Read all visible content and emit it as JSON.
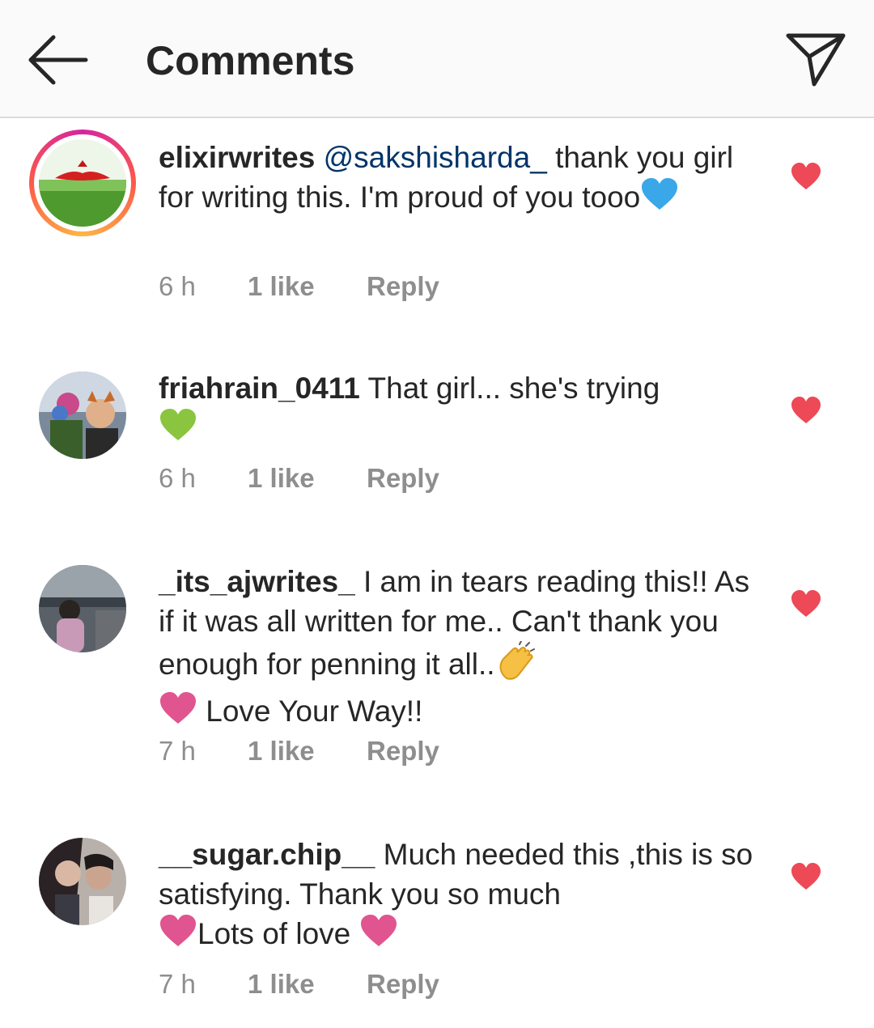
{
  "header": {
    "title": "Comments",
    "back_icon": "arrow-left-icon",
    "send_icon": "paper-plane-icon"
  },
  "colors": {
    "like_heart": "#ed4956",
    "meta_text": "#8e8e8e",
    "mention": "#003569",
    "blue_heart": "#3aa7e8",
    "green_heart": "#8bc53f",
    "pink_heart": "#e0558f"
  },
  "comments": [
    {
      "username": "elixirwrites",
      "mention": "@sakshisharda_",
      "text": "thank you girl for writing this. I'm proud of you tooo",
      "emoji_after": "blue-heart-icon",
      "time": "6 h",
      "likes": "1 like",
      "reply": "Reply",
      "has_story_ring": true
    },
    {
      "username": "friahrain_0411",
      "text": "That girl... she's trying",
      "emoji_after": "green-heart-icon",
      "time": "6 h",
      "likes": "1 like",
      "reply": "Reply"
    },
    {
      "username": "_its_ajwrites_",
      "text": "I am in tears reading this!! As if it was  all written for me.. Can't thank you enough for penning  it all..",
      "text_end": "Love Your Way!!",
      "emojis": [
        "clapping-hands-icon",
        "pink-heart-icon"
      ],
      "time": "7 h",
      "likes": "1 like",
      "reply": "Reply"
    },
    {
      "username": "__sugar.chip__",
      "text": "Much needed this ,this is so satisfying. Thank you so much",
      "text_end": "Lots of love",
      "emojis": [
        "pink-heart-icon",
        "pink-heart-icon"
      ],
      "time": "7 h",
      "likes": "1 like",
      "reply": "Reply"
    }
  ]
}
